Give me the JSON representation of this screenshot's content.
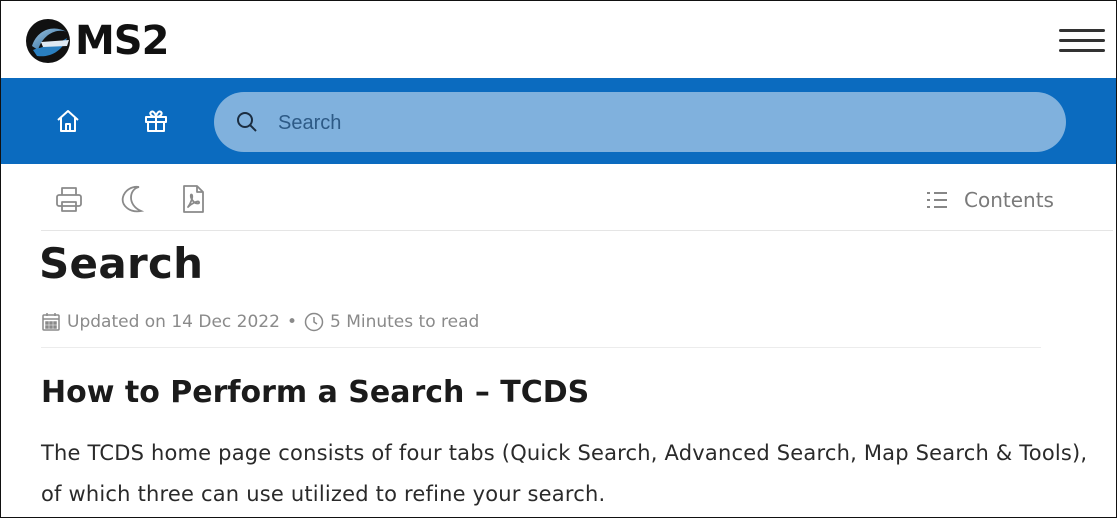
{
  "brand": {
    "name": "MS2"
  },
  "nav": {
    "search_placeholder": "Search"
  },
  "toolbar": {
    "contents_label": "Contents"
  },
  "article": {
    "title": "Search",
    "updated": "Updated on 14 Dec 2022",
    "separator": "•",
    "read_time": "5 Minutes to read",
    "section_heading": "How to Perform a Search – TCDS",
    "paragraph": "The TCDS home page consists of four tabs (Quick Search, Advanced Search, Map Search & Tools), of which three can use utilized to refine your search."
  },
  "colors": {
    "nav_band": "#0b6bbf",
    "search_pill": "#80b1dd",
    "text_dark": "#1b1b1b",
    "text_muted": "#8a8a8a"
  },
  "icons": [
    "home-icon",
    "gift-icon",
    "search-icon",
    "print-icon",
    "moon-icon",
    "pdf-icon",
    "list-icon",
    "calendar-icon",
    "clock-icon",
    "hamburger-icon"
  ]
}
